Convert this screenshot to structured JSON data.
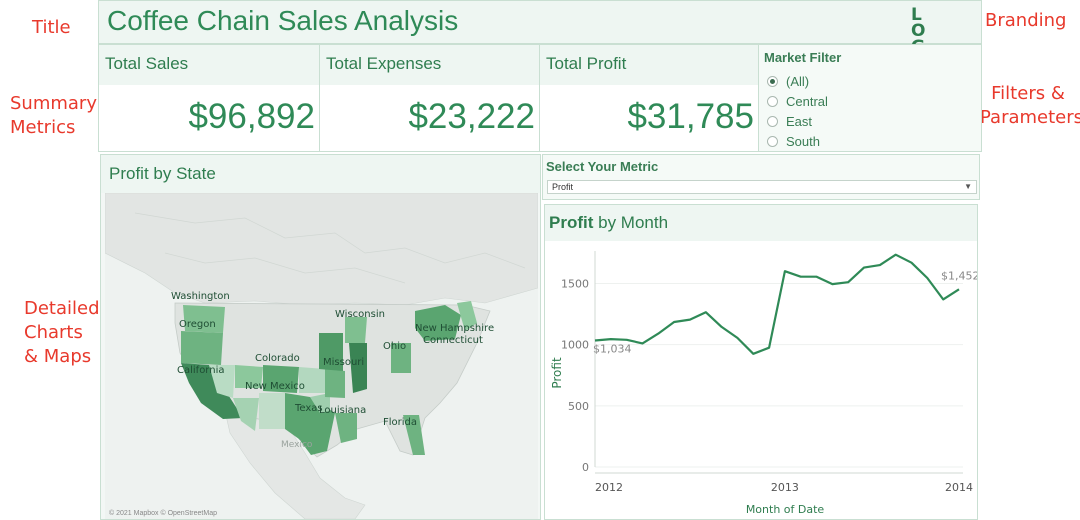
{
  "annotations": {
    "title": "Title",
    "branding": "Branding",
    "summary_metrics": [
      "Summary",
      "Metrics"
    ],
    "filters": [
      "Filters &",
      "Parameters"
    ],
    "detailed": [
      "Detailed",
      "Charts",
      "& Maps"
    ]
  },
  "header": {
    "title": "Coffee Chain Sales Analysis",
    "logo": [
      "L O",
      "G O"
    ]
  },
  "kpis": [
    {
      "label": "Total Sales",
      "value": "$96,892"
    },
    {
      "label": "Total Expenses",
      "value": "$23,222"
    },
    {
      "label": "Total Profit",
      "value": "$31,785"
    }
  ],
  "market_filter": {
    "title": "Market Filter",
    "options": [
      "(All)",
      "Central",
      "East",
      "South"
    ],
    "selected": "(All)"
  },
  "map": {
    "title": "Profit by State",
    "credit": "© 2021 Mapbox © OpenStreetMap",
    "state_labels": [
      "Washington",
      "Oregon",
      "Wisconsin",
      "New Hampshire",
      "Connecticut",
      "Colorado",
      "California",
      "Missouri",
      "Ohio",
      "New Mexico",
      "Texas",
      "Louisiana",
      "Florida",
      "Mexico"
    ]
  },
  "metric_selector": {
    "title": "Select Your Metric",
    "value": "Profit"
  },
  "chart": {
    "title_emph": "Profit",
    "title_rest": " by Month"
  },
  "chart_data": {
    "type": "line",
    "ylabel": "Profit",
    "xlabel": "Month of Date",
    "x_ticks": [
      "2012",
      "2013",
      "2014"
    ],
    "y_ticks": [
      0,
      500,
      1000,
      1500
    ],
    "ylim": [
      0,
      1700
    ],
    "series": [
      {
        "values": [
          1034,
          1045,
          1040,
          1010,
          1090,
          1185,
          1205,
          1265,
          1145,
          1055,
          925,
          975,
          1600,
          1555,
          1555,
          1495,
          1510,
          1630,
          1650,
          1735,
          1670,
          1545,
          1370,
          1452
        ]
      }
    ],
    "annotations": [
      {
        "index": 0,
        "label": "$1,034"
      },
      {
        "index": 23,
        "label": "$1,452"
      }
    ],
    "color": "#2f8a57"
  },
  "colors": {
    "accent": "#2f8a57",
    "annotation": "#e8392c",
    "header_bg": "#eef6f2"
  }
}
